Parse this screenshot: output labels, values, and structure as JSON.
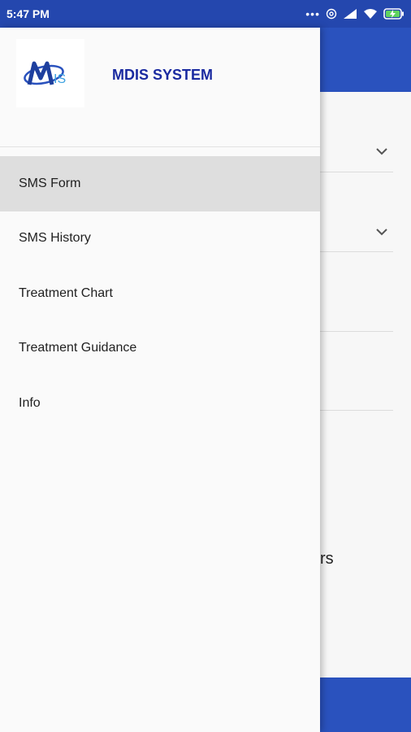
{
  "status_bar": {
    "time": "5:47 PM"
  },
  "drawer": {
    "app_name": "MDIS SYSTEM",
    "logo_text": "MDIS",
    "items": [
      {
        "label": "SMS Form",
        "selected": true
      },
      {
        "label": "SMS History",
        "selected": false
      },
      {
        "label": "Treatment Chart",
        "selected": false
      },
      {
        "label": "Treatment Guidance",
        "selected": false
      },
      {
        "label": "Info",
        "selected": false
      }
    ]
  },
  "background": {
    "partial_text": "rs"
  },
  "colors": {
    "primary": "#2a52be",
    "app_name": "#1a2aa0",
    "selected_bg": "#dedede"
  }
}
